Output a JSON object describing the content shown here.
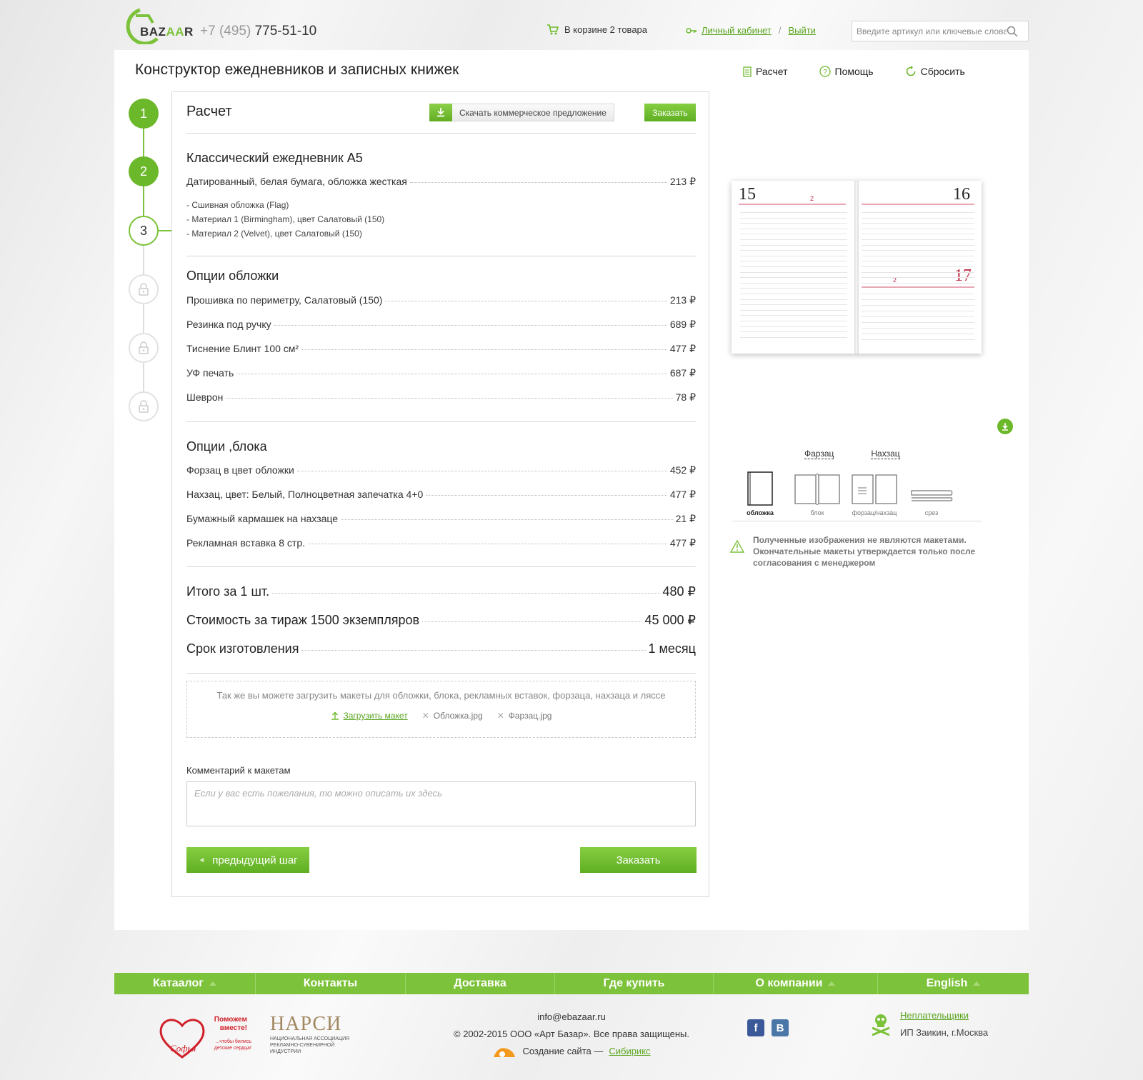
{
  "header": {
    "logo_text_a": "BAZ",
    "logo_text_b": "AA",
    "logo_text_c": "R",
    "phone_prefix": "+7 (495)",
    "phone_number": "775-51-10",
    "cart_text": "В корзине 2 товара",
    "account_link": "Личный кабинет",
    "account_sep": "/",
    "logout_link": "Выйти",
    "search_placeholder": "Введите артикул или ключевые слова"
  },
  "page": {
    "title": "Конструктор ежедневников и записных книжек",
    "actions": {
      "calc": "Расчет",
      "help": "Помощь",
      "reset": "Сбросить"
    }
  },
  "steps": [
    {
      "label": "1",
      "state": "done"
    },
    {
      "label": "2",
      "state": "done"
    },
    {
      "label": "3",
      "state": "active"
    },
    {
      "label": "",
      "state": "locked"
    },
    {
      "label": "",
      "state": "locked"
    },
    {
      "label": "",
      "state": "locked"
    }
  ],
  "calc": {
    "title": "Расчет",
    "download_btn": "Скачать коммерческое предложение",
    "order_small_btn": "Заказать",
    "product": {
      "title": "Классический ежедневник А5",
      "line": {
        "label": "Датированный, белая бумага, обложка жесткая",
        "value": "213 ₽"
      },
      "details": [
        "- Сшивная обложка (Flag)",
        "- Материал 1 (Birmingham), цвет Салатовый (150)",
        "- Материал 2 (Velvet), цвет Салатовый (150)"
      ]
    },
    "cover_options": {
      "title": "Опции обложки",
      "rows": [
        {
          "label": "Прошивка по периметру, Салатовый (150)",
          "value": "213 ₽"
        },
        {
          "label": "Резинка под ручку",
          "value": "689 ₽"
        },
        {
          "label": "Тиснение Блинт 100 см²",
          "value": "477 ₽"
        },
        {
          "label": "УФ печать",
          "value": "687 ₽"
        },
        {
          "label": "Шеврон",
          "value": "78 ₽"
        }
      ]
    },
    "block_options": {
      "title": "Опции ,блока",
      "rows": [
        {
          "label": "Форзац в цвет обложки",
          "value": "452 ₽"
        },
        {
          "label": "Нахзац, цвет: Белый, Полноцветная запечатка 4+0",
          "value": "477 ₽"
        },
        {
          "label": "Бумажный кармашек на нахзаце",
          "value": "21 ₽"
        },
        {
          "label": "Рекламная вставка 8 стр.",
          "value": "477 ₽"
        }
      ]
    },
    "totals": [
      {
        "label": "Итого за 1 шт.",
        "value": "480 ₽"
      },
      {
        "label": "Стоимость за тираж 1500 экземпляров",
        "value": "45 000 ₽"
      },
      {
        "label": "Срок изготовления",
        "value": "1 месяц"
      }
    ],
    "upload": {
      "text": "Так же вы можете загрузить макеты для обложки, блока, рекламных вставок, форзаца, нахзаца и ляссе",
      "upload_link": "Загрузить макет",
      "files": [
        "Обложка.jpg",
        "Фарзац.jpg"
      ]
    },
    "comment_label": "Комментарий к макетам",
    "comment_placeholder": "Если у вас есть пожелания, то можно описать их здесь",
    "prev_btn": "предыдущий шаг",
    "order_btn": "Заказать"
  },
  "preview": {
    "day_left": "15",
    "day_right_top": "16",
    "day_right_bottom": "17",
    "small_left_1": "2",
    "small_right_1": "2",
    "link_forzac": "Фарзац",
    "link_nahzac": "Нахзац",
    "views": [
      "обложка",
      "блок",
      "форзац/нахзац",
      "срез"
    ],
    "warning": "Полученные изображения не являются макетами. Окончательные макеты утверждается только после согласования с менеджером"
  },
  "footer": {
    "nav": [
      {
        "label": "Катаалог",
        "arrow": true
      },
      {
        "label": "Контакты",
        "arrow": false
      },
      {
        "label": "Доставка",
        "arrow": false
      },
      {
        "label": "Где купить",
        "arrow": false
      },
      {
        "label": "О компании",
        "arrow": true
      },
      {
        "label": "English",
        "arrow": true
      }
    ],
    "charity_line1": "Поможем",
    "charity_line2": "вместе!",
    "charity_line3": "...чтобы бились",
    "charity_line4": "детские сердца!",
    "charity_logo": "Софья",
    "narsi_title": "НАРСИ",
    "narsi_sub": "НАЦИОНАЛЬНАЯ АССОЦИАЦИЯ РЕКЛАМНО-СУВЕНИРНОЙ ИНДУСТРИИ",
    "email": "info@ebazaar.ru",
    "copyright": "© 2002-2015 ООО «Арт Базар». Все права защищены.",
    "created_prefix": "Создание сайта —",
    "created_link": "Сибирикс",
    "social": [
      "f",
      "В"
    ],
    "debtors_link": "Неплательщики",
    "debtors_text": "ИП Заикин, г.Москва"
  },
  "colors": {
    "accent": "#7cc23a",
    "accent_dark": "#5fae22",
    "price_red": "#c0304a"
  }
}
